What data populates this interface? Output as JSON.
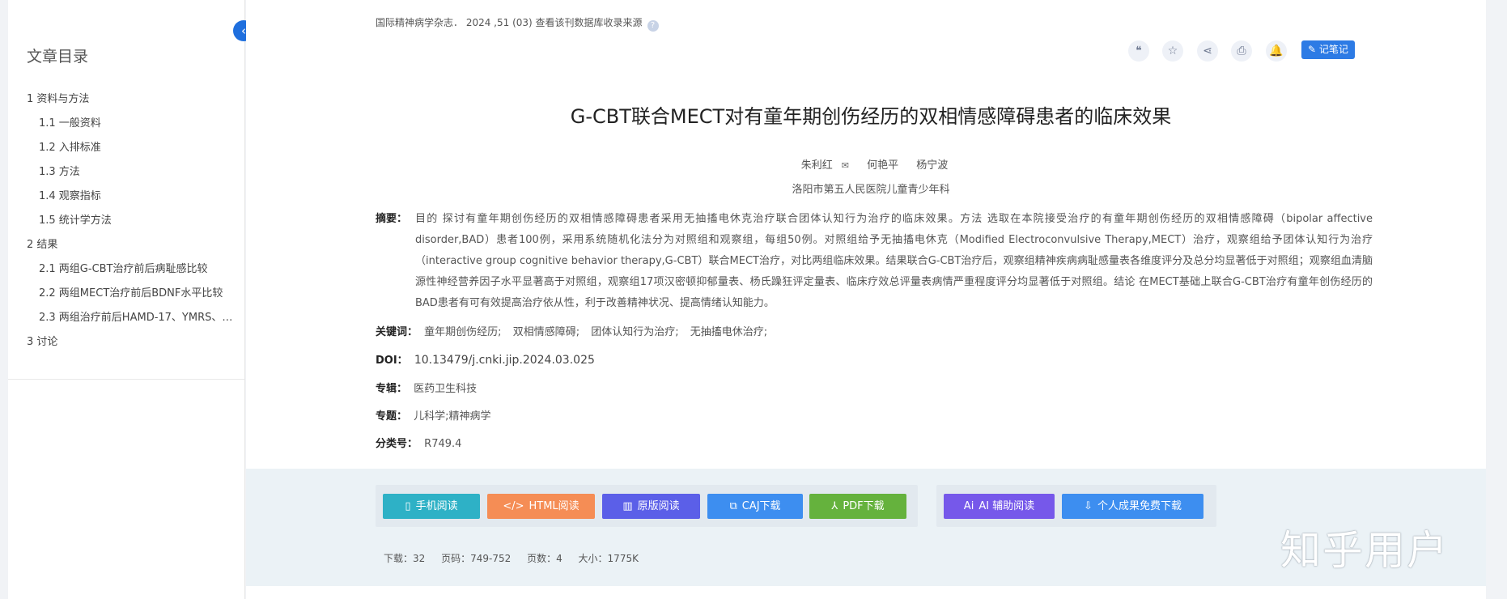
{
  "sidebar": {
    "title": "文章目录",
    "items": [
      {
        "label": "1 资料与方法",
        "level": 1
      },
      {
        "label": "1.1 一般资料",
        "level": 2
      },
      {
        "label": "1.2 入排标准",
        "level": 2
      },
      {
        "label": "1.3 方法",
        "level": 2
      },
      {
        "label": "1.4 观察指标",
        "level": 2
      },
      {
        "label": "1.5 统计学方法",
        "level": 2
      },
      {
        "label": "2 结果",
        "level": 1
      },
      {
        "label": "2.1 两组G-CBT治疗前后病耻感比较",
        "level": 2
      },
      {
        "label": "2.2 两组MECT治疗前后BDNF水平比较",
        "level": 2
      },
      {
        "label": "2.3 两组治疗前后HAMD-17、YMRS、…",
        "level": 2
      },
      {
        "label": "3 讨论",
        "level": 1
      }
    ]
  },
  "source": {
    "text": "国际精神病学杂志． 2024 ,51 (03)  查看该刊数据库收录来源",
    "help": "?"
  },
  "toolbar": {
    "cite": "❝",
    "favorite": "☆",
    "share": "⋖",
    "print": "⎙",
    "notify": "🔔",
    "note_label": "记笔记"
  },
  "article": {
    "title": "G-CBT联合MECT对有童年期创伤经历的双相情感障碍患者的临床效果",
    "authors": [
      "朱利红",
      "何艳平",
      "杨宁波"
    ],
    "mail_icon": "✉",
    "affiliation": "洛阳市第五人民医院儿童青少年科",
    "abstract_label": "摘要：",
    "abstract": "目的 探讨有童年期创伤经历的双相情感障碍患者采用无抽搐电休克治疗联合团体认知行为治疗的临床效果。方法 选取在本院接受治疗的有童年期创伤经历的双相情感障碍（bipolar affective disorder,BAD）患者100例，采用系统随机化法分为对照组和观察组，每组50例。对照组给予无抽搐电休克（Modified Electroconvulsive Therapy,MECT）治疗，观察组给予团体认知行为治疗（interactive group cognitive behavior therapy,G-CBT）联合MECT治疗，对比两组临床效果。结果联合G-CBT治疗后，观察组精神疾病病耻感量表各维度评分及总分均显著低于对照组；观察组血清脑源性神经营养因子水平显著高于对照组，观察组17项汉密顿抑郁量表、杨氏躁狂评定量表、临床疗效总评量表病情严重程度评分均显著低于对照组。结论 在MECT基础上联合G-CBT治疗有童年创伤经历的BAD患者有可有效提高治疗依从性，利于改善精神状况、提高情绪认知能力。",
    "keywords_label": "关键词：",
    "keywords": [
      "童年期创伤经历;",
      "双相情感障碍;",
      "团体认知行为治疗;",
      "无抽搐电休治疗;"
    ],
    "doi_label": "DOI：",
    "doi": "10.13479/j.cnki.jip.2024.03.025",
    "series_label": "专辑：",
    "series": "医药卫生科技",
    "topic_label": "专题：",
    "topic": "儿科学;精神病学",
    "class_label": "分类号：",
    "class": "R749.4"
  },
  "actions": [
    {
      "label": "手机阅读",
      "icon": "▯",
      "color": "#2eb1c6"
    },
    {
      "label": "HTML阅读",
      "icon": "</>",
      "color": "#f58d55"
    },
    {
      "label": "原版阅读",
      "icon": "▥",
      "color": "#5b5fe8"
    },
    {
      "label": "CAJ下载",
      "icon": "⧉",
      "color": "#3d8ef0"
    },
    {
      "label": "PDF下载",
      "icon": "⅄",
      "color": "#65b23d"
    },
    {
      "label": "AI 辅助阅读",
      "icon": "Ai",
      "color": "#7658ea"
    },
    {
      "label": "个人成果免费下载",
      "icon": "⇩",
      "color": "#3d8ef0"
    }
  ],
  "stats": {
    "downloads": "下载：32",
    "pages": "页码：749-752",
    "page_count": "页数：4",
    "size": "大小：1775K"
  },
  "watermark": "知乎用户",
  "collapse_icon": "‹"
}
